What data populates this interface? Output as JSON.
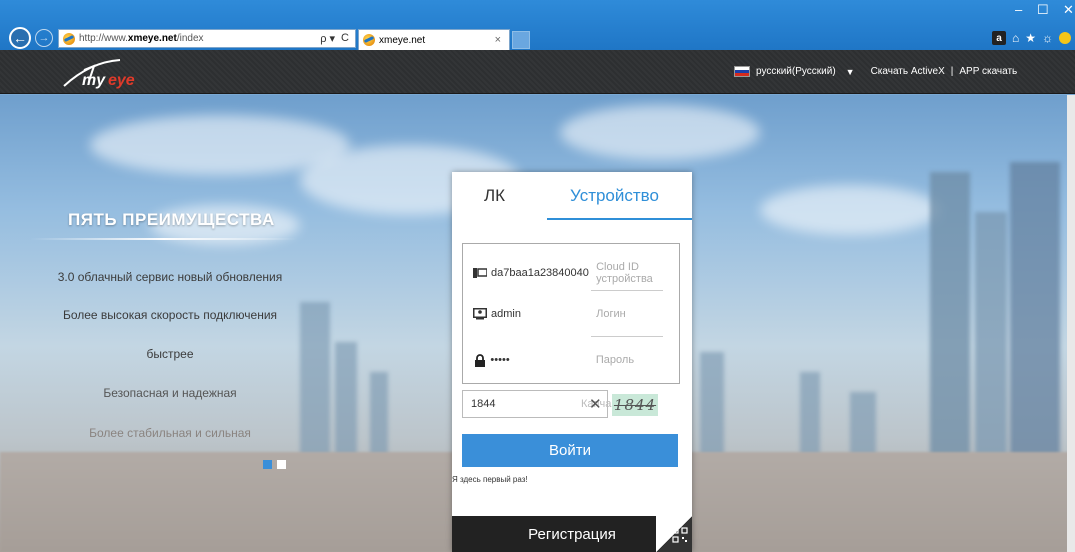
{
  "browser": {
    "url_prefix": "http://www.",
    "url_domain": "xmeye.net",
    "url_suffix": "/index",
    "tab_title": "xmeye.net",
    "tab_close": "×",
    "search_icon": "ρ ▾",
    "refresh_icon": "C",
    "min": "–",
    "max": "☐",
    "close": "✕",
    "amazon_icon": "a",
    "home_icon": "⌂",
    "star_icon": "★",
    "gear_icon": "☼"
  },
  "header": {
    "language": "русский(Русский)",
    "caret": "▼",
    "activex": "Скачать ActiveX",
    "separator": "|",
    "app": "APP скачать"
  },
  "promo": {
    "title": "ПЯТЬ ПРЕИМУЩЕСТВА",
    "features": [
      "3.0 облачный сервис новый обновления",
      "Более высокая скорость подключения",
      "быстрее",
      "Безопасная и надежная",
      "Более стабильная и сильная"
    ]
  },
  "login": {
    "tab_lk": "ЛК",
    "tab_device": "Устройство",
    "cloud_id_value": "da7baa1a23840040",
    "cloud_id_placeholder": "Cloud ID устройства",
    "login_value": "admin",
    "login_placeholder": "Логин",
    "password_value": "•••••",
    "password_placeholder": "Пароль",
    "captcha_value": "1844",
    "captcha_placeholder": "Капча",
    "captcha_clear": "✕",
    "captcha_image_text": "1844",
    "login_button": "Войти",
    "first_time": "Я здесь первый раз!",
    "register": "Регистрация"
  },
  "colors": {
    "accent": "#3a8fd9",
    "header_bg": "#2d2f31",
    "register_bg": "#222222"
  }
}
